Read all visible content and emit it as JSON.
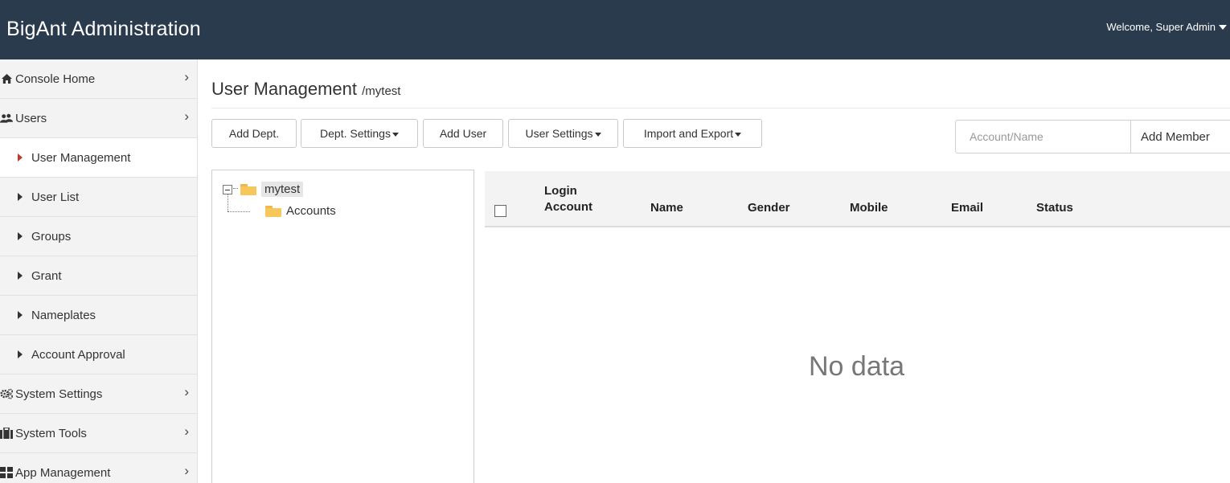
{
  "header": {
    "brand": "BigAnt Administration",
    "welcome": "Welcome, Super Admin"
  },
  "sidebar": {
    "items": [
      {
        "label": "Console Home",
        "icon": "home-icon"
      },
      {
        "label": "Users",
        "icon": "users-icon"
      },
      {
        "label": "System Settings",
        "icon": "gears-icon"
      },
      {
        "label": "System Tools",
        "icon": "toolbox-icon"
      },
      {
        "label": "App Management",
        "icon": "grid-icon"
      }
    ],
    "sub_items": [
      {
        "label": "User Management",
        "active": true
      },
      {
        "label": "User List"
      },
      {
        "label": "Groups"
      },
      {
        "label": "Grant"
      },
      {
        "label": "Nameplates"
      },
      {
        "label": "Account Approval"
      }
    ]
  },
  "main": {
    "title": "User Management",
    "path": "/mytest",
    "toolbar": {
      "add_dept": "Add Dept.",
      "dept_settings": "Dept. Settings",
      "add_user": "Add User",
      "user_settings": "User Settings",
      "import_export": "Import and Export"
    },
    "search": {
      "placeholder": "Account/Name",
      "value": ""
    },
    "add_member": "Add Member",
    "tree": {
      "root": "mytest",
      "children": [
        "Accounts"
      ]
    },
    "table": {
      "columns": [
        "Login Account",
        "Name",
        "Gender",
        "Mobile",
        "Email",
        "Status"
      ],
      "column_first_line": "Login",
      "column_second_line": "Account",
      "rows": [],
      "empty_text": "No data"
    }
  },
  "colors": {
    "header_bg": "#2b3b4e",
    "sidebar_bg": "#f3f3f3",
    "active_marker": "#c0392b",
    "folder": "#f7c75c"
  }
}
